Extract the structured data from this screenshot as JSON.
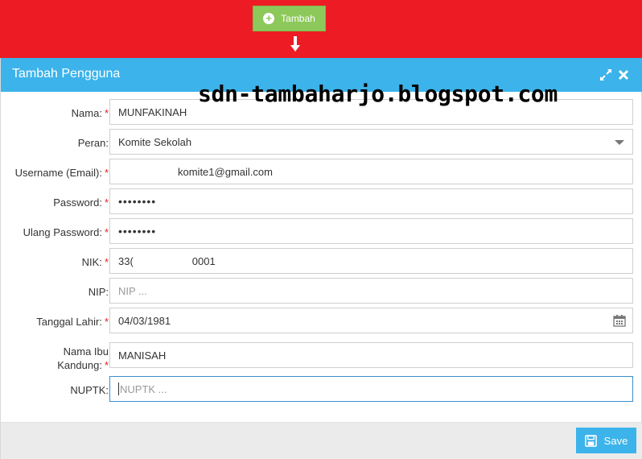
{
  "toolbar": {
    "tambah_label": "Tambah"
  },
  "dialog": {
    "title": "Tambah Pengguna"
  },
  "watermark": "sdn-tambaharjo.blogspot.com",
  "form": {
    "nama": {
      "label": "Nama:",
      "value": "MUNFAKINAH"
    },
    "peran": {
      "label": "Peran:",
      "value": "Komite Sekolah"
    },
    "username": {
      "label": "Username (Email):",
      "value": "komite1@gmail.com"
    },
    "password": {
      "label": "Password:",
      "value": "••••••••"
    },
    "ulang_password": {
      "label": "Ulang Password:",
      "value": "••••••••"
    },
    "nik": {
      "label": "NIK:",
      "value_start": "33(",
      "value_end": "0001"
    },
    "nip": {
      "label": "NIP:",
      "placeholder": "NIP ..."
    },
    "tanggal_lahir": {
      "label": "Tanggal Lahir:",
      "value": "04/03/1981"
    },
    "nama_ibu": {
      "label_line1": "Nama Ibu",
      "label_line2": "Kandung:",
      "value": "MANISAH"
    },
    "nuptk": {
      "label": "NUPTK:",
      "placeholder": "NUPTK ..."
    }
  },
  "required_mark": "*",
  "footer": {
    "save_label": "Save"
  },
  "colors": {
    "top_band": "#ed1c24",
    "header": "#3cb3ea",
    "tambah": "#8dc85a",
    "required": "#e02020"
  },
  "icons": [
    "plus-circle-icon",
    "down-arrow-icon",
    "expand-icon",
    "close-icon",
    "chevron-down-icon",
    "calendar-icon",
    "save-icon"
  ]
}
